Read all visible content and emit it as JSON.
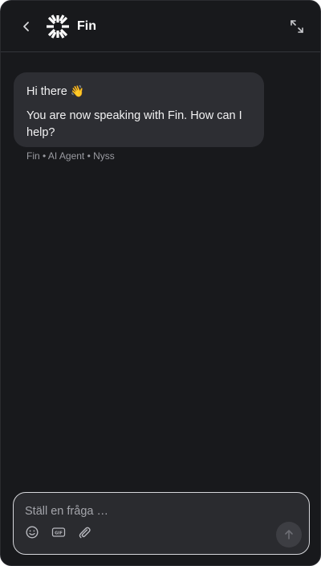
{
  "header": {
    "title": "Fin",
    "back_icon": "chevron-left-icon",
    "expand_icon": "expand-icon",
    "logo": "fin-logo"
  },
  "conversation": {
    "greeting": "Hi there",
    "greeting_emoji": "👋",
    "message": "You are now speaking with Fin. How can I help?",
    "meta": "Fin • AI Agent • Nyss"
  },
  "composer": {
    "placeholder": "Ställ en fråga …",
    "value": "",
    "tools": [
      "emoji-icon",
      "gif-icon",
      "paperclip-icon"
    ],
    "send_icon": "arrow-up-icon"
  },
  "colors": {
    "background": "#18191c",
    "bubble": "#2d2e33",
    "text": "#ffffff",
    "muted": "#9a9ba1"
  }
}
